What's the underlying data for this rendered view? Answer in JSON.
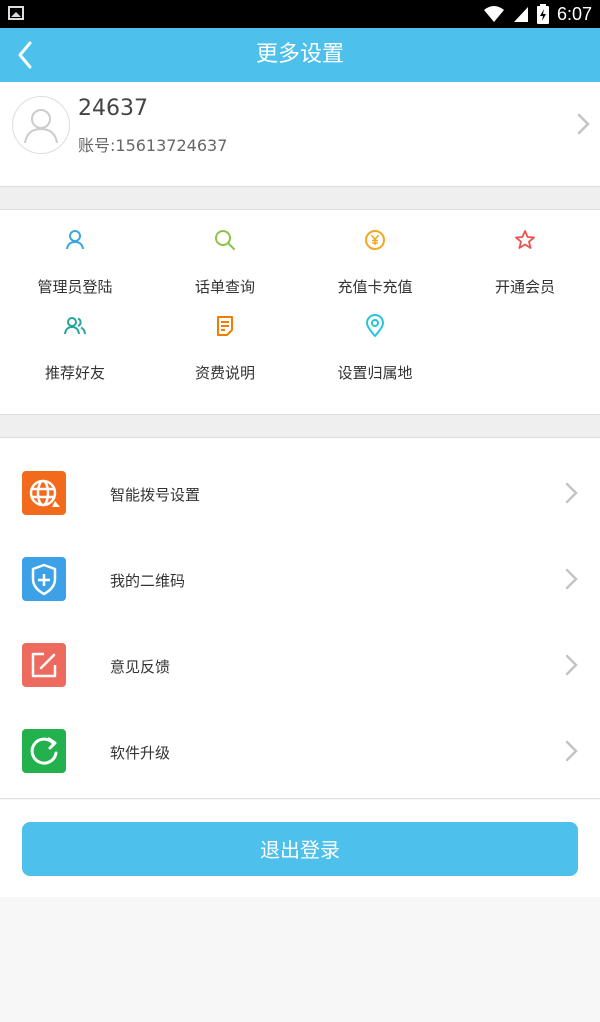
{
  "status_bar": {
    "time": "6:07",
    "icons": [
      "image-icon",
      "wifi-icon",
      "signal-icon",
      "battery-icon"
    ]
  },
  "header": {
    "title": "更多设置",
    "back_icon": "back-arrow-icon",
    "color": "#4dc0ec"
  },
  "profile": {
    "name": "24637",
    "account": "账号:15613724637"
  },
  "grid": [
    {
      "label": "管理员登陆",
      "icon": "user-icon",
      "color": "#3aa7e0"
    },
    {
      "label": "话单查询",
      "icon": "search-icon",
      "color": "#8bc34a"
    },
    {
      "label": "充值卡充值",
      "icon": "yen-icon",
      "color": "#f5a623"
    },
    {
      "label": "开通会员",
      "icon": "star-icon",
      "color": "#ef5350"
    },
    {
      "label": "推荐好友",
      "icon": "users-icon",
      "color": "#26a69a"
    },
    {
      "label": "资费说明",
      "icon": "document-icon",
      "color": "#f57c00"
    },
    {
      "label": "设置归属地",
      "icon": "location-icon",
      "color": "#26c6da"
    }
  ],
  "list": [
    {
      "label": "智能拨号设置",
      "icon": "globe-icon",
      "color": "#f26b1d"
    },
    {
      "label": "我的二维码",
      "icon": "shield-plus-icon",
      "color": "#3da1e8"
    },
    {
      "label": "意见反馈",
      "icon": "edit-icon",
      "color": "#ef6a5e"
    },
    {
      "label": "软件升级",
      "icon": "refresh-icon",
      "color": "#22b14c"
    }
  ],
  "logout_label": "退出登录"
}
